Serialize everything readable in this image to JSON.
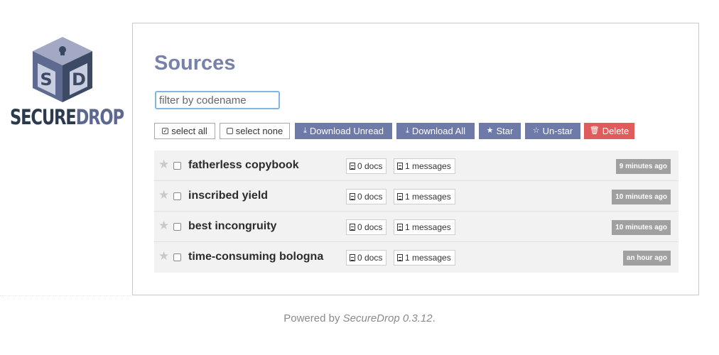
{
  "logo": {
    "secure": "SECURE",
    "drop": "DROP",
    "cube_letters": [
      "S",
      "D"
    ]
  },
  "page": {
    "title": "Sources",
    "filter_placeholder": "filter by codename"
  },
  "toolbar": {
    "select_all": "select all",
    "select_none": "select none",
    "download_unread": "Download Unread",
    "download_all": "Download All",
    "star": "Star",
    "unstar": "Un-star",
    "delete": "Delete"
  },
  "sources": [
    {
      "name": "fatherless copybook",
      "docs": "0 docs",
      "messages": "1 messages",
      "time": "9 minutes ago"
    },
    {
      "name": "inscribed yield",
      "docs": "0 docs",
      "messages": "1 messages",
      "time": "10 minutes ago"
    },
    {
      "name": "best incongruity",
      "docs": "0 docs",
      "messages": "1 messages",
      "time": "10 minutes ago"
    },
    {
      "name": "time-consuming bologna",
      "docs": "0 docs",
      "messages": "1 messages",
      "time": "an hour ago"
    }
  ],
  "footer": {
    "prefix": "Powered by ",
    "product": "SecureDrop 0.3.12",
    "suffix": "."
  },
  "colors": {
    "accent": "#7781a9",
    "button_blue": "#6e7aa7",
    "button_red": "#e05c5c",
    "logo_dark": "#2b3a4f"
  },
  "icons": {
    "select_all": "check-square-icon",
    "select_none": "square-icon",
    "download": "download-icon",
    "star": "star-icon",
    "unstar": "star-half-icon",
    "delete": "trash-icon",
    "docs": "file-icon",
    "messages": "file-text-icon"
  }
}
